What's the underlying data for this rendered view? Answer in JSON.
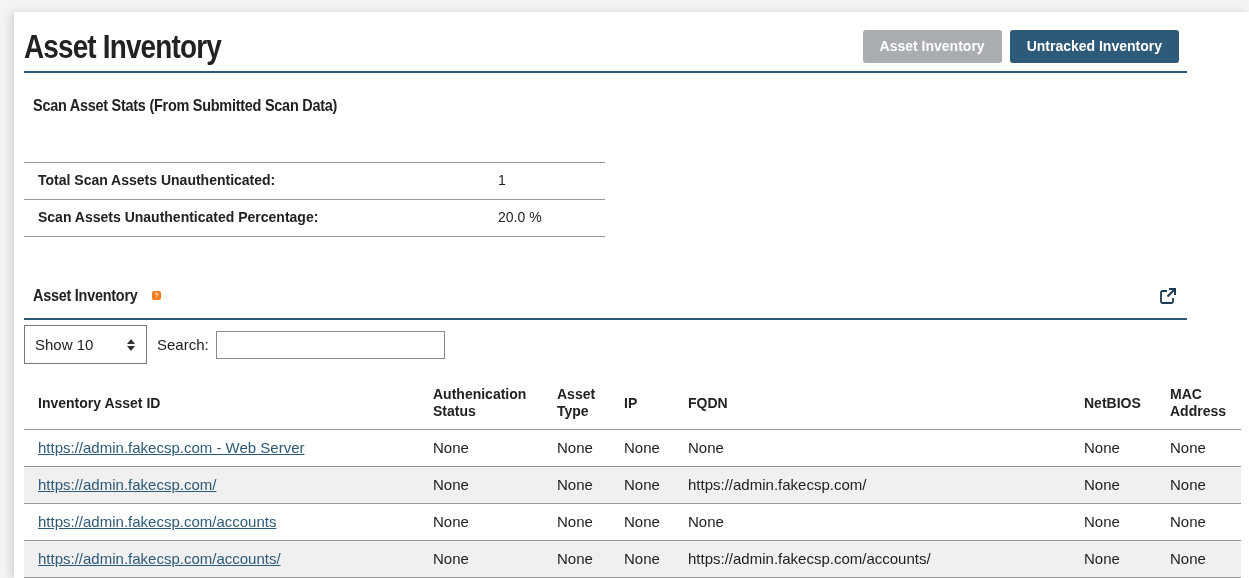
{
  "page_title": "Asset Inventory",
  "header_buttons": [
    {
      "label": "Asset Inventory",
      "disabled": true
    },
    {
      "label": "Untracked Inventory",
      "disabled": false
    }
  ],
  "stats": {
    "title": "Scan Asset Stats (From Submitted Scan Data)",
    "rows": [
      {
        "label": "Total Scan Assets Unauthenticated:",
        "value": "1"
      },
      {
        "label": "Scan Assets Unauthenticated Percentage:",
        "value": "20.0 %"
      }
    ]
  },
  "inventory": {
    "title": "Asset Inventory",
    "page_size": "Show 10",
    "search_label": "Search:",
    "columns": [
      "Inventory Asset ID",
      "Authenication Status",
      "Asset Type",
      "IP",
      "FQDN",
      "NetBIOS",
      "MAC Address"
    ],
    "rows": [
      [
        "https://admin.fakecsp.com - Web Server",
        "None",
        "None",
        "None",
        "None",
        "None",
        "None"
      ],
      [
        "https://admin.fakecsp.com/",
        "None",
        "None",
        "None",
        "https://admin.fakecsp.com/",
        "None",
        "None"
      ],
      [
        "https://admin.fakecsp.com/accounts",
        "None",
        "None",
        "None",
        "None",
        "None",
        "None"
      ],
      [
        "https://admin.fakecsp.com/accounts/",
        "None",
        "None",
        "None",
        "https://admin.fakecsp.com/accounts/",
        "None",
        "None"
      ]
    ]
  }
}
